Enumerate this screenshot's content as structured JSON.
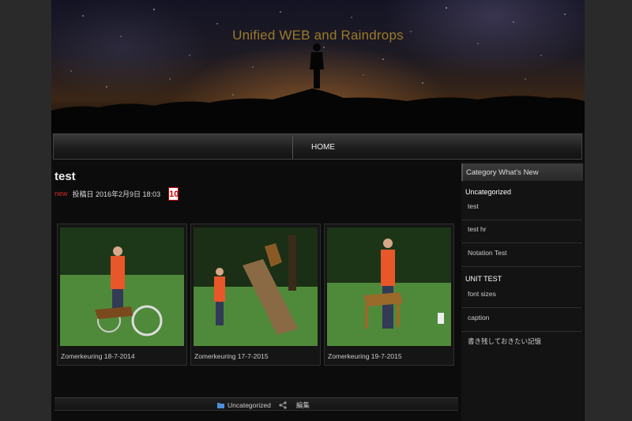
{
  "header": {
    "site_title": "Unified WEB and Raindrops"
  },
  "nav": {
    "home_label": "HOME"
  },
  "post": {
    "title": "test",
    "new_label": "new",
    "date_label": "投稿日 2016年2月9日 18:03",
    "comment_count": "10",
    "gallery": [
      {
        "caption": "Zomerkeuring 18-7-2014"
      },
      {
        "caption": "Zomerkeuring 17-7-2015"
      },
      {
        "caption": "Zomerkeuring 19-7-2015"
      }
    ],
    "footer": {
      "category": "Uncategorized",
      "edit": "編集"
    }
  },
  "sidebar": {
    "heading": "Category What's New",
    "groups": [
      {
        "title": "Uncategorized",
        "items": [
          "test",
          "test hr",
          "Notation Test"
        ]
      },
      {
        "title": "UNIT TEST",
        "items": [
          "font sizes",
          "caption",
          "書き残しておきたい記憶"
        ]
      }
    ]
  },
  "colors": {
    "new_badge": "#d42b2b",
    "count_badge": "#cc0000",
    "title_gold": "#9a7a2a"
  }
}
